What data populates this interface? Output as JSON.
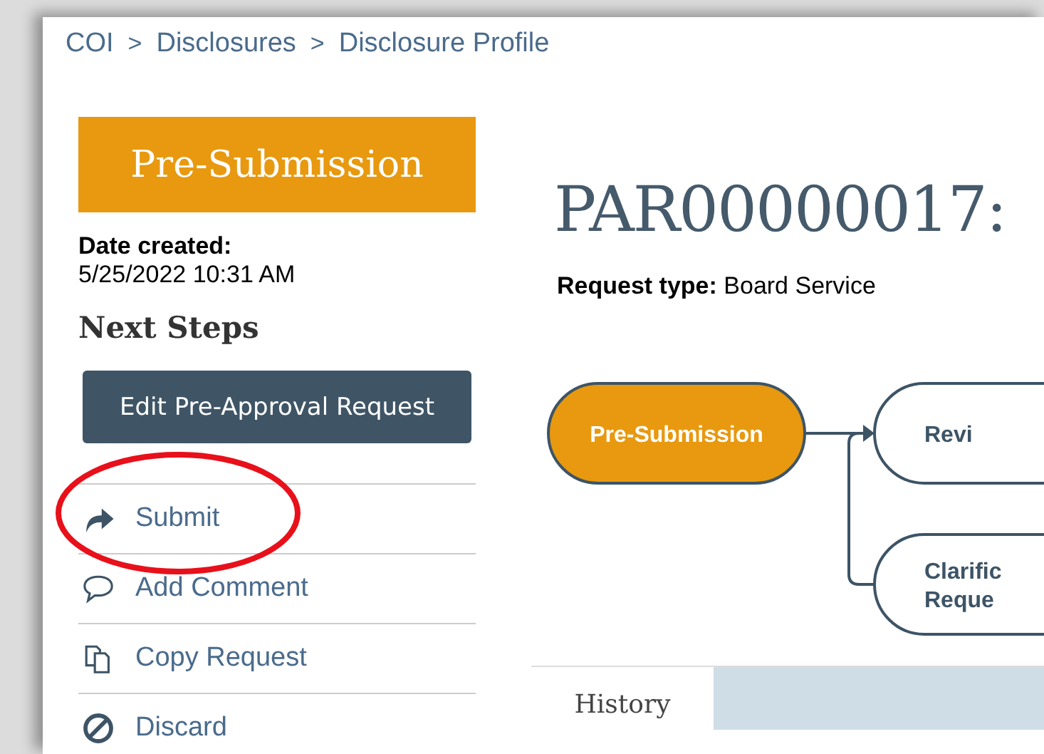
{
  "breadcrumb": [
    {
      "label": "COI",
      "separator": ">"
    },
    {
      "label": "Disclosures",
      "separator": ">"
    },
    {
      "label": "Disclosure Profile"
    }
  ],
  "status": {
    "label": "Pre-Submission"
  },
  "date_created": {
    "label": "Date created:",
    "value": "5/25/2022 10:31 AM"
  },
  "next_steps": {
    "heading": "Next Steps",
    "primary_button": "Edit Pre-Approval Request",
    "actions": [
      {
        "label": "Submit",
        "kind": "submit",
        "highlighted": true
      },
      {
        "label": "Add Comment",
        "kind": "comment",
        "highlighted": false
      },
      {
        "label": "Copy Request",
        "kind": "copy",
        "highlighted": false
      },
      {
        "label": "Discard",
        "kind": "discard",
        "highlighted": false
      }
    ]
  },
  "title": "PAR00000017:",
  "request_type": {
    "label": "Request type:",
    "value": "Board Service"
  },
  "workflow": {
    "nodes": [
      {
        "lines": [
          "Pre-Submission"
        ],
        "current": true
      },
      {
        "lines": [
          "Revi"
        ],
        "current": false
      },
      {
        "lines": [
          "Clarific",
          "Reque"
        ],
        "current": false
      }
    ]
  },
  "tabs": [
    {
      "label": "History",
      "selected": true
    }
  ]
}
